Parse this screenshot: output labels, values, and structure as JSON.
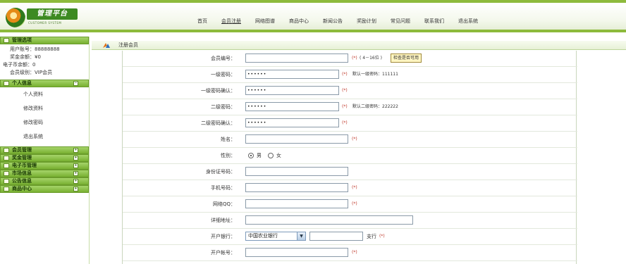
{
  "logo": {
    "name": "管理平台",
    "sub": "CUSTOMER SYSTEM"
  },
  "nav": [
    {
      "label": "首页"
    },
    {
      "label": "会员注册"
    },
    {
      "label": "网络图谱"
    },
    {
      "label": "商品中心"
    },
    {
      "label": "新闻公告"
    },
    {
      "label": "奖励计划"
    },
    {
      "label": "常见问题"
    },
    {
      "label": "联系我们"
    },
    {
      "label": "退出系统"
    }
  ],
  "sidebar": {
    "manage_title": "管理选项",
    "info": {
      "account": "用户账号：88888888",
      "bonus": "奖金余额：¥0",
      "ecoin": "电子币余额：0",
      "level": "会员级别：VIP会员"
    },
    "personal": {
      "title": "个人信息",
      "items": [
        "个人资料",
        "修改资料",
        "修改密码",
        "退出系统"
      ]
    },
    "sections": [
      "会员管理",
      "奖金管理",
      "电子币管理",
      "市场信息",
      "公告信息",
      "商品中心"
    ]
  },
  "content": {
    "title": "注册会员",
    "form": {
      "member_id": {
        "label": "会员编号：",
        "value": "",
        "req": "(*)",
        "hint": "( 4－16位 )",
        "check_button": "检查是否可用"
      },
      "pwd1": {
        "label": "一级密码：",
        "value": "••••••",
        "req": "(*)",
        "hint": "默认一级密码：111111"
      },
      "pwd1_confirm": {
        "label": "一级密码确认：",
        "value": "••••••",
        "req": "(*)"
      },
      "pwd2": {
        "label": "二级密码：",
        "value": "••••••",
        "req": "(*)",
        "hint": "默认二级密码：222222"
      },
      "pwd2_confirm": {
        "label": "二级密码确认：",
        "value": "••••••",
        "req": "(*)"
      },
      "name": {
        "label": "姓名：",
        "value": "",
        "req": "(*)"
      },
      "gender": {
        "label": "性别：",
        "male": "男",
        "female": "女",
        "selected": "男"
      },
      "id_card": {
        "label": "身份证号码：",
        "value": ""
      },
      "mobile": {
        "label": "手机号码：",
        "value": "",
        "req": "(*)"
      },
      "qq": {
        "label": "网络QQ：",
        "value": "",
        "req": "(*)"
      },
      "address": {
        "label": "详细地址：",
        "value": ""
      },
      "bank": {
        "label": "开户银行：",
        "selected": "中国农业银行",
        "branch_value": "",
        "branch_suffix": "支行",
        "req": "(*)"
      },
      "bank_account": {
        "label": "开户帐号：",
        "value": "",
        "req": "(*)"
      }
    }
  }
}
